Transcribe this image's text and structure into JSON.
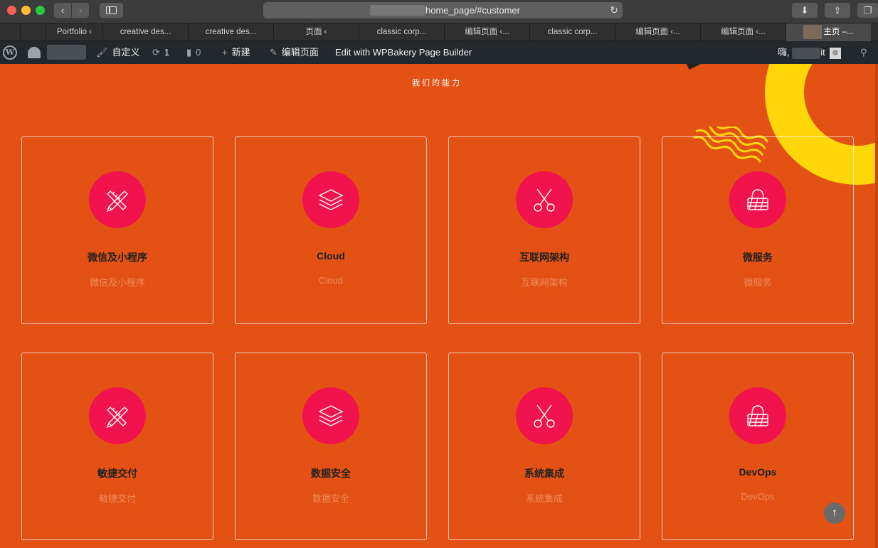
{
  "browser": {
    "url": "home_page/#customer",
    "tabs": [
      {
        "label": "Portfolio ‹"
      },
      {
        "label": "creative des..."
      },
      {
        "label": "creative des..."
      },
      {
        "label": "页面 ‹"
      },
      {
        "label": "classic corp..."
      },
      {
        "label": "编辑页面 ‹..."
      },
      {
        "label": "classic corp..."
      },
      {
        "label": "编辑页面 ‹..."
      },
      {
        "label": "编辑页面 ‹..."
      },
      {
        "label": "主页 –..."
      }
    ]
  },
  "adminbar": {
    "customize": "自定义",
    "updates": "1",
    "comments": "0",
    "new": "新建",
    "edit_page": "编辑页面",
    "wpbakery": "Edit with WPBakery Page Builder",
    "greeting": "嗨,",
    "user_suffix": "it"
  },
  "section": {
    "title": "我们的能力"
  },
  "cards": [
    {
      "title": "微信及小程序",
      "subtitle": "微信及小程序",
      "icon": "pencil-ruler-icon"
    },
    {
      "title": "Cloud",
      "subtitle": "Cloud",
      "icon": "layers-icon"
    },
    {
      "title": "互联网架构",
      "subtitle": "互联网架构",
      "icon": "scissors-icon"
    },
    {
      "title": "微服务",
      "subtitle": "微服务",
      "icon": "basket-icon"
    },
    {
      "title": "敏捷交付",
      "subtitle": "敏捷交付",
      "icon": "pencil-ruler-icon"
    },
    {
      "title": "数据安全",
      "subtitle": "数据安全",
      "icon": "layers-icon"
    },
    {
      "title": "系统集成",
      "subtitle": "系统集成",
      "icon": "scissors-icon"
    },
    {
      "title": "DevOps",
      "subtitle": "DevOps",
      "icon": "basket-icon"
    }
  ],
  "colors": {
    "page_bg": "#e35114",
    "icon_circle": "#f0134d",
    "deco_yellow": "#ffd60a",
    "adminbar_bg": "#23282d"
  }
}
